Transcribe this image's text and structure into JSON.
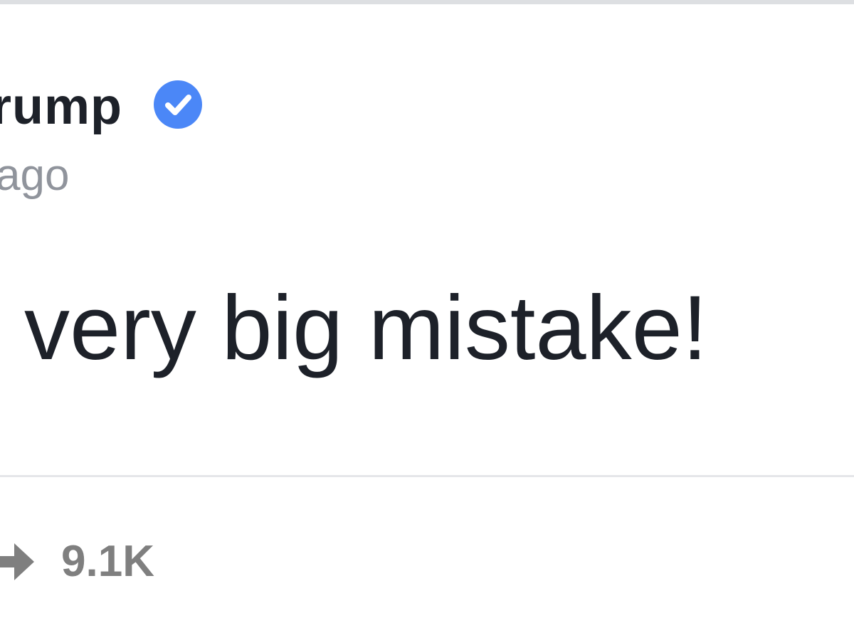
{
  "post": {
    "author": "rump",
    "verified_icon": "verified-badge-icon",
    "timestamp": "ago",
    "text": "very big mistake!",
    "share_icon": "share-arrow-icon",
    "share_count": "9.1K"
  },
  "colors": {
    "verified_badge": "#4b87f7",
    "text": "#1d2129",
    "muted": "#90949c",
    "share": "#7f7f7f"
  }
}
